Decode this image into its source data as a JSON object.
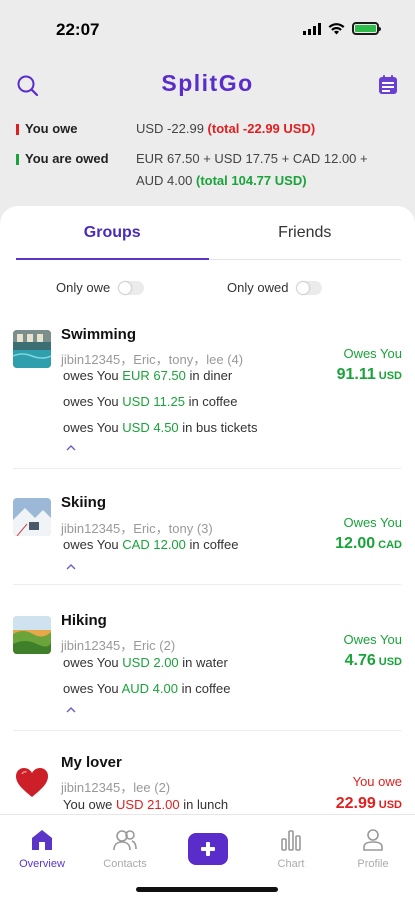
{
  "status_bar": {
    "time": "22:07"
  },
  "header": {
    "title": "SplitGo"
  },
  "summary": {
    "you_owe_label": "You owe",
    "you_owe_value": "USD -22.99",
    "you_owe_total": "(total -22.99 USD)",
    "you_are_owed_label": "You are owed",
    "you_are_owed_value_line1": "EUR 67.50 + USD 17.75 + CAD 12.00 +",
    "you_are_owed_value_line2": "AUD 4.00",
    "you_are_owed_total": "(total 104.77 USD)"
  },
  "tabs": {
    "groups": "Groups",
    "friends": "Friends"
  },
  "filters": {
    "only_owe": "Only owe",
    "only_owed": "Only owed"
  },
  "groups": [
    {
      "name": "Swimming",
      "members": "jibin12345，Eric，tony，lee (4)",
      "status": "Owes You",
      "amount": "91.11",
      "currency": "USD",
      "lines": [
        {
          "prefix": "owes You",
          "amount": "EUR 67.50",
          "suffix": "in diner"
        },
        {
          "prefix": "owes You",
          "amount": "USD 11.25",
          "suffix": "in coffee"
        },
        {
          "prefix": "owes You",
          "amount": "USD 4.50",
          "suffix": "in bus tickets"
        }
      ]
    },
    {
      "name": "Skiing",
      "members": "jibin12345，Eric，tony (3)",
      "status": "Owes You",
      "amount": "12.00",
      "currency": "CAD",
      "lines": [
        {
          "prefix": "owes You",
          "amount": "CAD 12.00",
          "suffix": "in coffee"
        }
      ]
    },
    {
      "name": "Hiking",
      "members": "jibin12345，Eric (2)",
      "status": "Owes You",
      "amount": "4.76",
      "currency": "USD",
      "lines": [
        {
          "prefix": "owes You",
          "amount": "USD 2.00",
          "suffix": "in water"
        },
        {
          "prefix": "owes You",
          "amount": "AUD 4.00",
          "suffix": "in coffee"
        }
      ]
    },
    {
      "name": "My lover",
      "members": "jibin12345，lee (2)",
      "status": "You owe",
      "amount": "22.99",
      "currency": "USD",
      "lines": [
        {
          "prefix": "You owe",
          "amount": "USD 21.00",
          "suffix": "in lunch"
        }
      ]
    }
  ],
  "nav": {
    "overview": "Overview",
    "contacts": "Contacts",
    "chart": "Chart",
    "profile": "Profile"
  },
  "colors": {
    "brand": "#5a2cc9",
    "positive": "#1aa33a",
    "negative": "#e02020"
  }
}
